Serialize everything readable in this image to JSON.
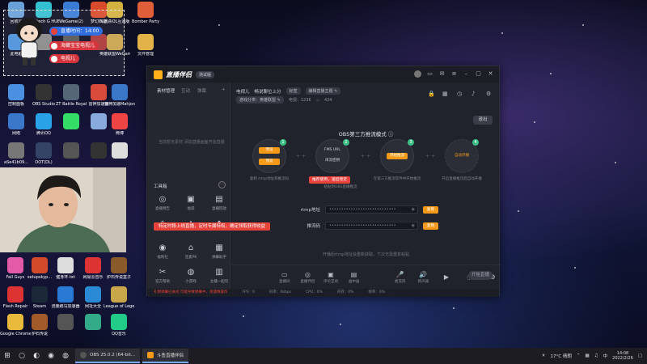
{
  "desktop_icons": [
    {
      "label": "回收站",
      "color": "#6aa0d8"
    },
    {
      "label": "Logitech G HUB",
      "color": "#33c0d0"
    },
    {
      "label": "WeGame(2)",
      "color": "#3a7bd5"
    },
    {
      "label": "梦幻西游",
      "color": "#d84b2a"
    },
    {
      "label": "三国杀OL互通版",
      "color": "#d3b23f"
    },
    {
      "label": "Bomber Party",
      "color": "#e05e3a"
    },
    {
      "label": "此电脑",
      "color": "#4a90d9"
    },
    {
      "label": "",
      "color": "#888"
    },
    {
      "label": "",
      "color": "#555"
    },
    {
      "label": "",
      "color": "#a33"
    },
    {
      "label": "英雄联盟WeGame版",
      "color": "#c7a24a"
    },
    {
      "label": "文件管理",
      "color": "#e3b34a"
    },
    {
      "label": "控制面板",
      "color": "#4a8fe0"
    },
    {
      "label": "OBS Studio",
      "color": "#333"
    },
    {
      "label": "ZT Battle Royale",
      "color": "#567"
    },
    {
      "label": "雷神加速器",
      "color": "#d94a3a"
    },
    {
      "label": "雷神加速Mahjong",
      "color": "#3a77c8"
    },
    {
      "label": "网络",
      "color": "#3a77c8"
    },
    {
      "label": "腾讯QQ",
      "color": "#2aa2e8"
    },
    {
      "label": "",
      "color": "#3d6"
    },
    {
      "label": "",
      "color": "#8ad"
    },
    {
      "label": "微博",
      "color": "#e44"
    },
    {
      "label": "aSe41b09...",
      "color": "#777"
    },
    {
      "label": "OOT(DL)",
      "color": "#346"
    },
    {
      "label": "",
      "color": "#555"
    },
    {
      "label": "",
      "color": "#333"
    },
    {
      "label": "",
      "color": "#ddd"
    }
  ],
  "bottom_icons": [
    {
      "label": "Fall Guys",
      "color": "#e25aa8"
    },
    {
      "label": "setupskyp...",
      "color": "#d24a2a"
    },
    {
      "label": "健身环.txt",
      "color": "#ddd"
    },
    {
      "label": "网易云音乐",
      "color": "#d33"
    },
    {
      "label": "炉石传说盒子",
      "color": "#8a5a2a"
    },
    {
      "label": "Flash Repair",
      "color": "#d33"
    },
    {
      "label": "Steam",
      "color": "#1b2838"
    },
    {
      "label": "流量跑马加速器",
      "color": "#2a7ad5"
    },
    {
      "label": "网址大全",
      "color": "#2a8ad5"
    },
    {
      "label": "League of Legends",
      "color": "#c8a64a"
    },
    {
      "label": "Google Chrome",
      "color": "#e8b93a"
    },
    {
      "label": "炉石传说",
      "color": "#a35a2a"
    },
    {
      "label": "",
      "color": "#555"
    },
    {
      "label": "",
      "color": "#3a8"
    },
    {
      "label": "QQ音乐",
      "color": "#2c8"
    }
  ],
  "overlay": {
    "live_time": "直播时间：14:00",
    "line1": "海藏宝宝电视儿",
    "line2": "电视儿"
  },
  "window": {
    "app_title": "直播伴侣",
    "version": "测试版",
    "titlebar_icons": [
      "user-avatar",
      "chat-icon",
      "message-icon",
      "menu-icon",
      "minimize-icon",
      "restore-icon",
      "close-icon"
    ],
    "left_tabs": [
      "素材管理",
      "互动",
      "弹幕"
    ],
    "placeholder": "当前暂无素材 添加直播画面开始直播",
    "tools_title": "工具箱",
    "tools": [
      {
        "label": "直播预告",
        "icon": "◎"
      },
      {
        "label": "福袋",
        "icon": "▣"
      },
      {
        "label": "直播回放",
        "icon": "▤"
      },
      {
        "label": "",
        "icon": "◈"
      },
      {
        "label": "",
        "icon": "▲"
      },
      {
        "label": "",
        "icon": "◆"
      },
      {
        "label": "福利社",
        "icon": "◉"
      },
      {
        "label": "连麦PK",
        "icon": "⌂"
      },
      {
        "label": "弹幕助手",
        "icon": "▦"
      },
      {
        "label": "官方帮助",
        "icon": "✂"
      },
      {
        "label": "小游戏",
        "icon": "◍"
      },
      {
        "label": "主播一起玩",
        "icon": "▥"
      }
    ],
    "tooltip": "特定时段上线直播，定时专属特权，确定领取获得收益",
    "header": {
      "title_label": "电视儿",
      "status": "畅说聊位上分",
      "tag": "标签",
      "category_label": "游戏分类",
      "category": "英雄联盟",
      "room_id": "电视：1236",
      "count": "424"
    },
    "header_icons": [
      "lock-icon",
      "shop-icon",
      "clock-icon",
      "bell-icon",
      "settings-icon"
    ],
    "mode_title": "OBS第三方推流模式 ⓘ",
    "exit_label": "退出",
    "steps": [
      {
        "num": "1",
        "badges": [
          "预设",
          "",
          "预设"
        ],
        "text": "复制 rtmp地址和推流码"
      },
      {
        "num": "2",
        "badges": [
          "FMS URL",
          "串流密钥"
        ],
        "text": "粘贴到OBS直播推流"
      },
      {
        "num": "3",
        "badges": [
          "开始推流"
        ],
        "text": "在第三方推流软件中开始推流"
      },
      {
        "num": "4",
        "badges": [
          "自动开播"
        ],
        "text": "开启直播推流后自动开播"
      }
    ],
    "hint": "推荐使用，速度稳定",
    "rtmp_label": "rtmp地址",
    "rtmp_value": "••••••••••••••••••••••••••••",
    "key_label": "推流码",
    "key_value": "••••••••••••••••••••••••••••",
    "copy_label": "复制",
    "note": "开播后rtmp地址会重新获取，下次无需重复粘贴",
    "bottom_tools": [
      {
        "label": "直播间",
        "icon": "▭"
      },
      {
        "label": "直播伴侣",
        "icon": "◎"
      },
      {
        "label": "评论互动",
        "icon": "▣"
      },
      {
        "label": "画中画",
        "icon": "▤"
      },
      {
        "label": "",
        "icon": ""
      },
      {
        "label": "麦克风",
        "icon": "🎤"
      },
      {
        "label": "扬声器",
        "icon": "🔊"
      },
      {
        "label": "",
        "icon": "▶"
      },
      {
        "label": "",
        "icon": "◌"
      },
      {
        "label": "",
        "icon": "⚙"
      }
    ],
    "start_label": "开始直播",
    "status_bar": [
      "礼物弹幕已关闭 可能导致弹幕中，请谨慎操作",
      "FPS：0",
      "码率：0kbps",
      "CPU：0%",
      "内存：0%",
      "帧率：0%"
    ]
  },
  "taskbar": {
    "tasks": [
      {
        "label": "OBS 25.0.2 (64-bit...",
        "color": "#333"
      },
      {
        "label": "斗鱼直播伴侣",
        "color": "#f59a18"
      }
    ],
    "weather": "17°C 晴朗",
    "time": "14:08",
    "date": "2022/2/26"
  }
}
